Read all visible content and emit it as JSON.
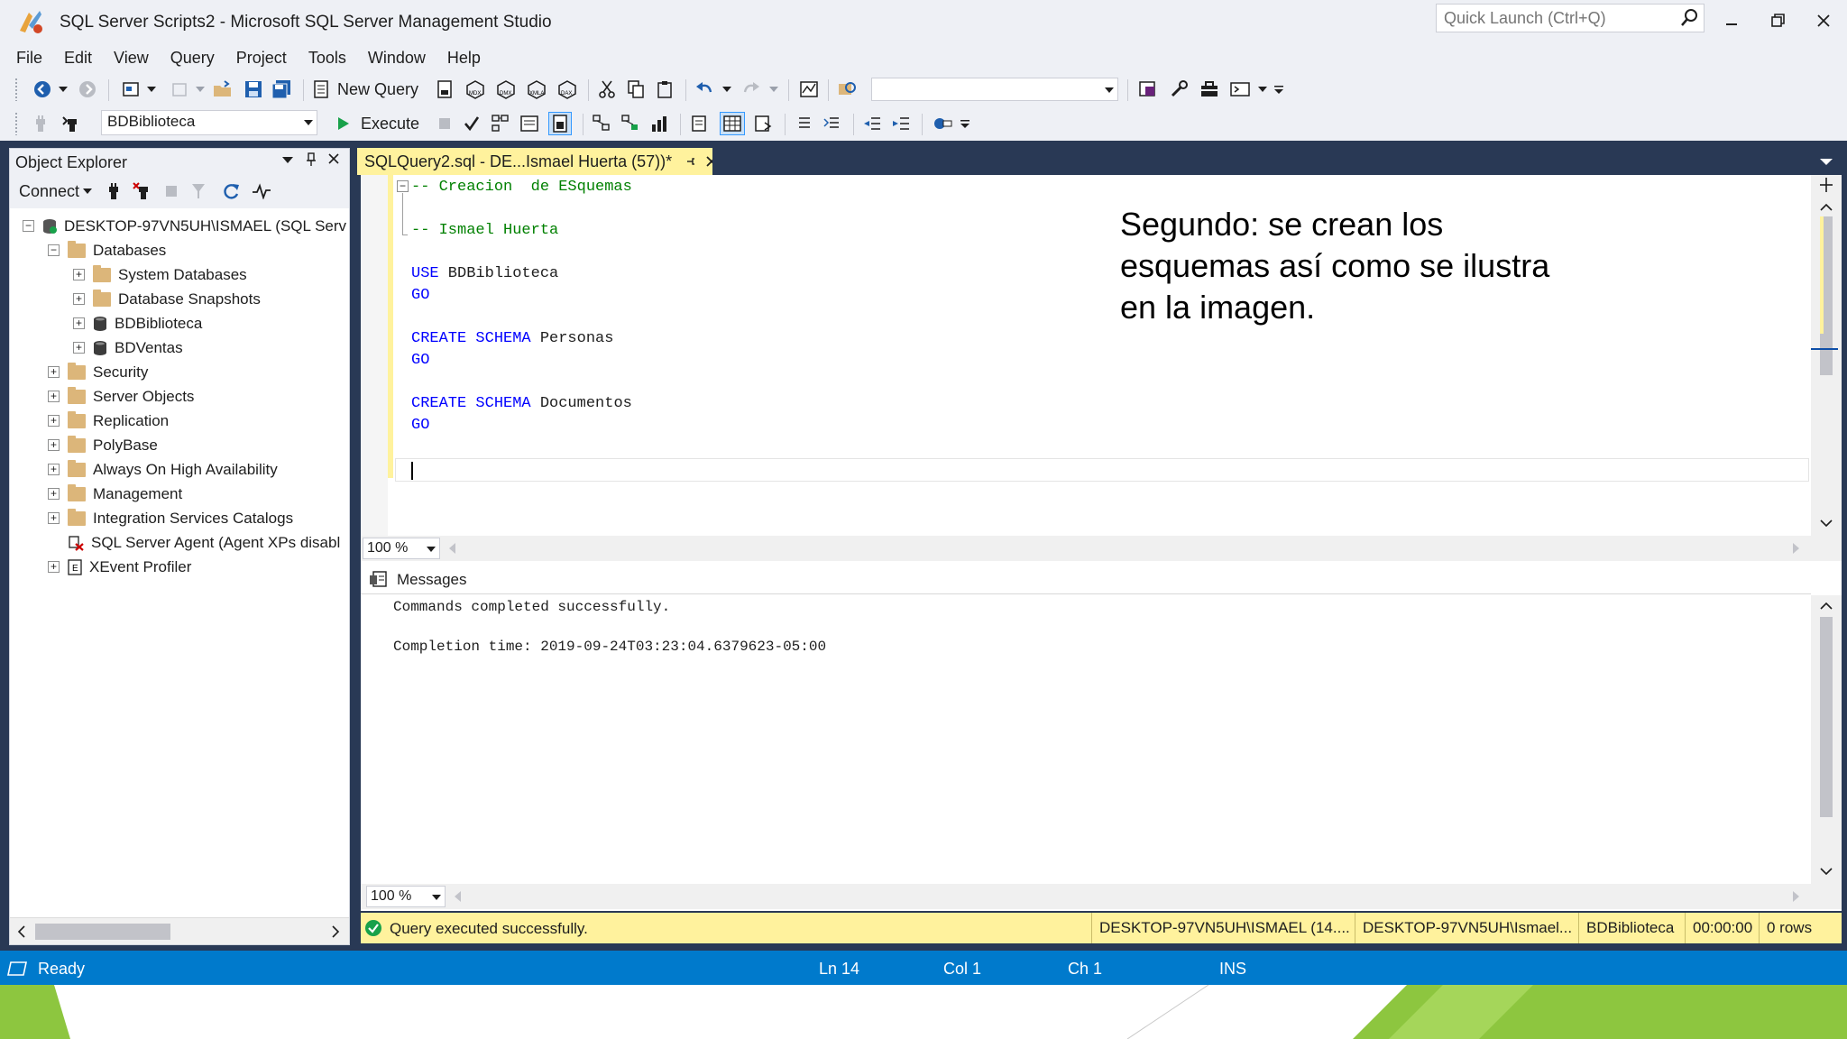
{
  "window": {
    "title": "SQL Server Scripts2 - Microsoft SQL Server Management Studio",
    "quick_launch_placeholder": "Quick Launch (Ctrl+Q)"
  },
  "menu": [
    "File",
    "Edit",
    "View",
    "Query",
    "Project",
    "Tools",
    "Window",
    "Help"
  ],
  "toolbar": {
    "new_query_label": "New Query",
    "database_value": "BDBiblioteca",
    "execute_label": "Execute"
  },
  "object_explorer": {
    "title": "Object Explorer",
    "connect_label": "Connect",
    "tree": [
      {
        "label": "DESKTOP-97VN5UH\\ISMAEL (SQL Serv",
        "expander": "−"
      },
      {
        "label": "Databases",
        "expander": "−"
      },
      {
        "label": "System Databases",
        "expander": "+"
      },
      {
        "label": "Database Snapshots",
        "expander": "+"
      },
      {
        "label": "BDBiblioteca",
        "expander": "+"
      },
      {
        "label": "BDVentas",
        "expander": "+"
      },
      {
        "label": "Security",
        "expander": "+"
      },
      {
        "label": "Server Objects",
        "expander": "+"
      },
      {
        "label": "Replication",
        "expander": "+"
      },
      {
        "label": "PolyBase",
        "expander": "+"
      },
      {
        "label": "Always On High Availability",
        "expander": "+"
      },
      {
        "label": "Management",
        "expander": "+"
      },
      {
        "label": "Integration Services Catalogs",
        "expander": "+"
      },
      {
        "label": "SQL Server Agent (Agent XPs disabl",
        "expander": ""
      },
      {
        "label": "XEvent Profiler",
        "expander": "+"
      }
    ]
  },
  "editor": {
    "tab_label": "SQLQuery2.sql - DE...Ismael Huerta (57))*",
    "lines": {
      "l1": "-- Creacion  de ESquemas",
      "l3": "-- Ismael Huerta",
      "use_kw": "USE",
      "use_db": " BDBiblioteca",
      "go": "GO",
      "create_kw": "CREATE SCHEMA",
      "schema1": " Personas",
      "schema2": " Documentos"
    },
    "annotation": [
      "Segundo: se crean los",
      "esquemas así como se ilustra",
      "en la imagen."
    ],
    "zoom": "100 %"
  },
  "results": {
    "tab_label": "Messages",
    "line1": "Commands completed successfully.",
    "line2": "Completion time: 2019-09-24T03:23:04.6379623-05:00",
    "zoom": "100 %"
  },
  "query_status": {
    "message": "Query executed successfully.",
    "server": "DESKTOP-97VN5UH\\ISMAEL (14....",
    "user": "DESKTOP-97VN5UH\\Ismael...",
    "database": "BDBiblioteca",
    "elapsed": "00:00:00",
    "rows": "0 rows"
  },
  "status_bar": {
    "ready": "Ready",
    "ln": "Ln 14",
    "col": "Col 1",
    "ch": "Ch 1",
    "mode": "INS"
  },
  "colors": {
    "accent": "#007acc",
    "tab_yellow": "#fff29d",
    "workspace": "#293955",
    "slide_green": "#8dc63f"
  }
}
